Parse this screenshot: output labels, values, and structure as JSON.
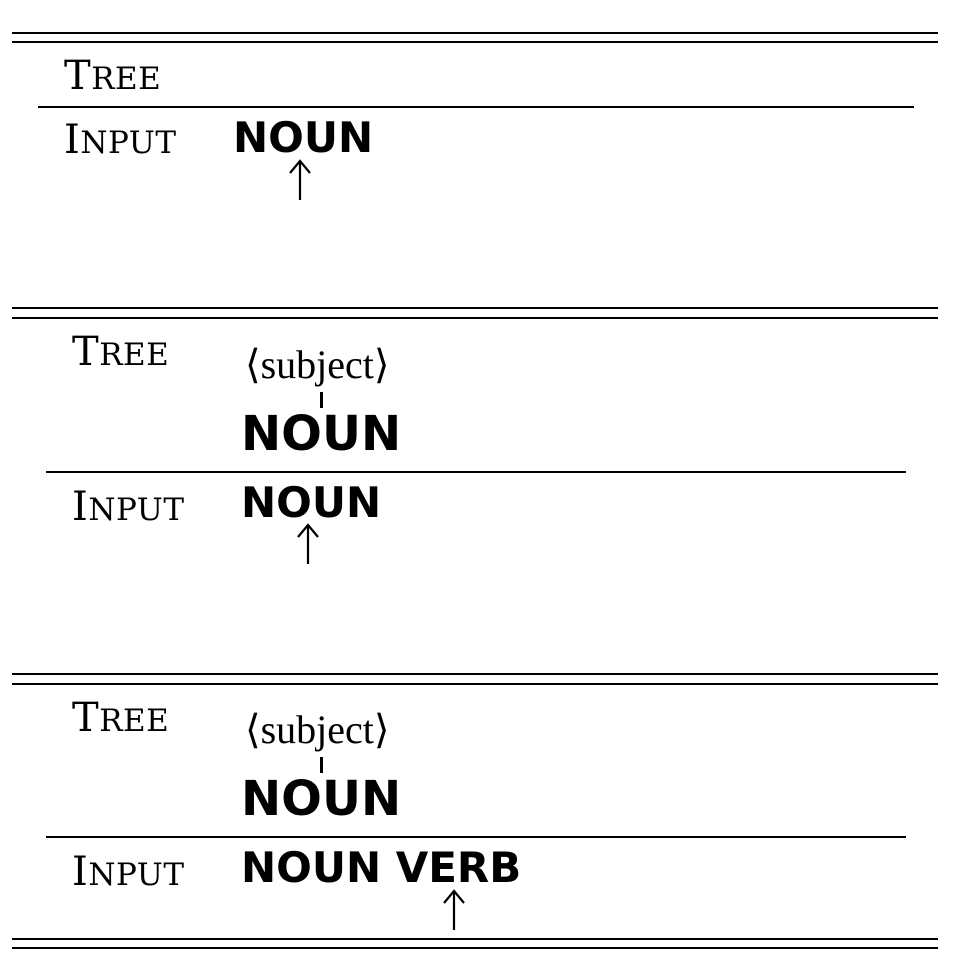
{
  "labels": {
    "tree": {
      "first": "T",
      "rest": "REE"
    },
    "input": {
      "first": "I",
      "rest": "NPUT"
    }
  },
  "panels": [
    {
      "tree_node": "",
      "tree_symbol": "",
      "input": "NOUN"
    },
    {
      "tree_node": "⟨subject⟩",
      "tree_symbol": "NOUN",
      "input": "NOUN"
    },
    {
      "tree_node": "⟨subject⟩",
      "tree_symbol": "NOUN",
      "input": "NOUN VERB"
    }
  ],
  "pointer_icon": "up-arrow-icon"
}
